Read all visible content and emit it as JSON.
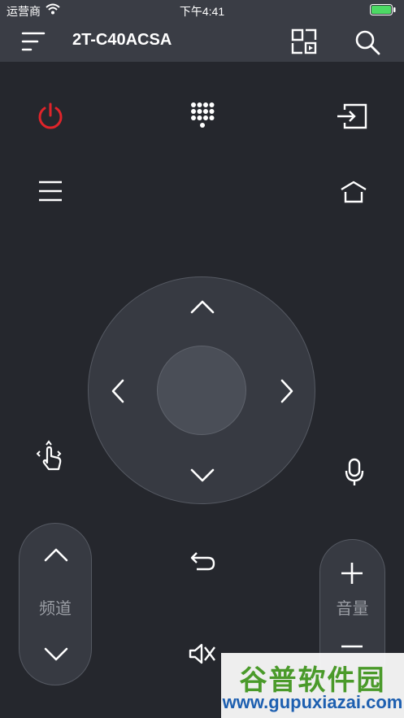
{
  "status_bar": {
    "carrier": "运营商",
    "time": "下午4:41",
    "battery_color": "#4cd964"
  },
  "header": {
    "device_name": "2T-C40ACSA",
    "icons": [
      "menu-icon",
      "screen-cast-icon",
      "search-icon"
    ]
  },
  "remote": {
    "power_color": "#e0242a",
    "icon_color": "#ffffff",
    "buttons": [
      "power-icon",
      "numpad-icon",
      "input-source-icon",
      "menu-lines-icon",
      "home-icon",
      "touch-gesture-icon",
      "mic-icon",
      "back-icon",
      "mute-icon"
    ],
    "dpad": [
      "up-arrow-icon",
      "down-arrow-icon",
      "left-arrow-icon",
      "right-arrow-icon",
      "ok-button"
    ],
    "channel_label": "频道",
    "volume_label": "音量"
  },
  "watermark": {
    "title": "谷普软件园",
    "url": "www.gupuxiazai.com"
  }
}
